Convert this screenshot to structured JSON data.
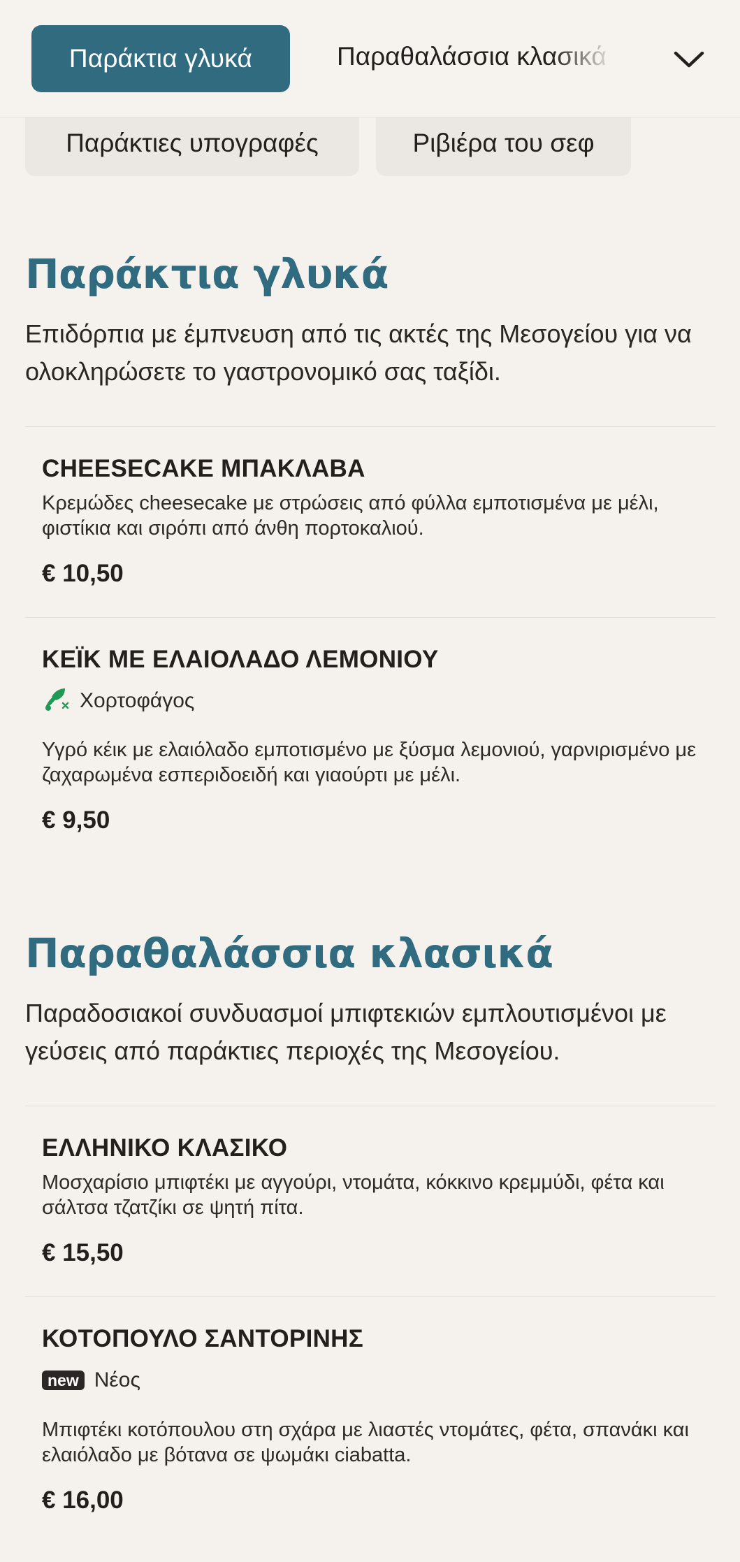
{
  "nav": {
    "active_tab": "Παράκτια γλυκά",
    "next_tab": "Παραθαλάσσια κλασικά",
    "chips": [
      "Παράκτιες υπογραφές",
      "Ριβιέρα του σεφ"
    ],
    "expand_icon": "chevron-down-icon"
  },
  "sections": [
    {
      "title": "Παράκτια γλυκά",
      "description": "Επιδόρπια με έμπνευση από τις ακτές της Μεσογείου για να ολοκληρώσετε το γαστρονομικό σας ταξίδι.",
      "items": [
        {
          "name": "CHEESECAKE ΜΠΑΚΛΑΒΑ",
          "description": "Κρεμώδες cheesecake με στρώσεις από φύλλα εμποτισμένα με μέλι, φιστίκια και σιρόπι από άνθη πορτοκαλιού.",
          "price": "€ 10,50"
        },
        {
          "name": "ΚΕΪΚ ΜΕ ΕΛΑΙΟΛΑΔΟ ΛΕΜΟΝΙΟΥ",
          "tag": "Χορτοφάγος",
          "tag_icon": "vegetarian-icon",
          "tag_color": "#1f9a55",
          "description": "Υγρό κέικ με ελαιόλαδο εμποτισμένο με ξύσμα λεμονιού, γαρνιρισμένο με ζαχαρωμένα εσπεριδοειδή και γιαούρτι με μέλι.",
          "price": "€ 9,50"
        }
      ]
    },
    {
      "title": "Παραθαλάσσια κλασικά",
      "description": "Παραδοσιακοί συνδυασμοί μπιφτεκιών εμπλουτισμένοι με γεύσεις από παράκτιες περιοχές της Μεσογείου.",
      "items": [
        {
          "name": "ΕΛΛΗΝΙΚΟ ΚΛΑΣΙΚΟ",
          "description": "Μοσχαρίσιο μπιφτέκι με αγγούρι, ντομάτα, κόκκινο κρεμμύδι, φέτα και σάλτσα τζατζίκι σε ψητή πίτα.",
          "price": "€ 15,50"
        },
        {
          "name": "ΚΟΤΟΠΟΥΛΟ ΣΑΝΤΟΡΙΝΗΣ",
          "badge": "new",
          "tag": "Νέος",
          "description": "Μπιφτέκι κοτόπουλου στη σχάρα με λιαστές ντομάτες, φέτα, σπανάκι και ελαιόλαδο με βότανα σε ψωμάκι ciabatta.",
          "price": "€ 16,00"
        }
      ]
    }
  ],
  "colors": {
    "accent": "#316b80",
    "background": "#f5f1ed",
    "chip": "#ebe7e2",
    "vegetarian": "#1f9a55"
  }
}
